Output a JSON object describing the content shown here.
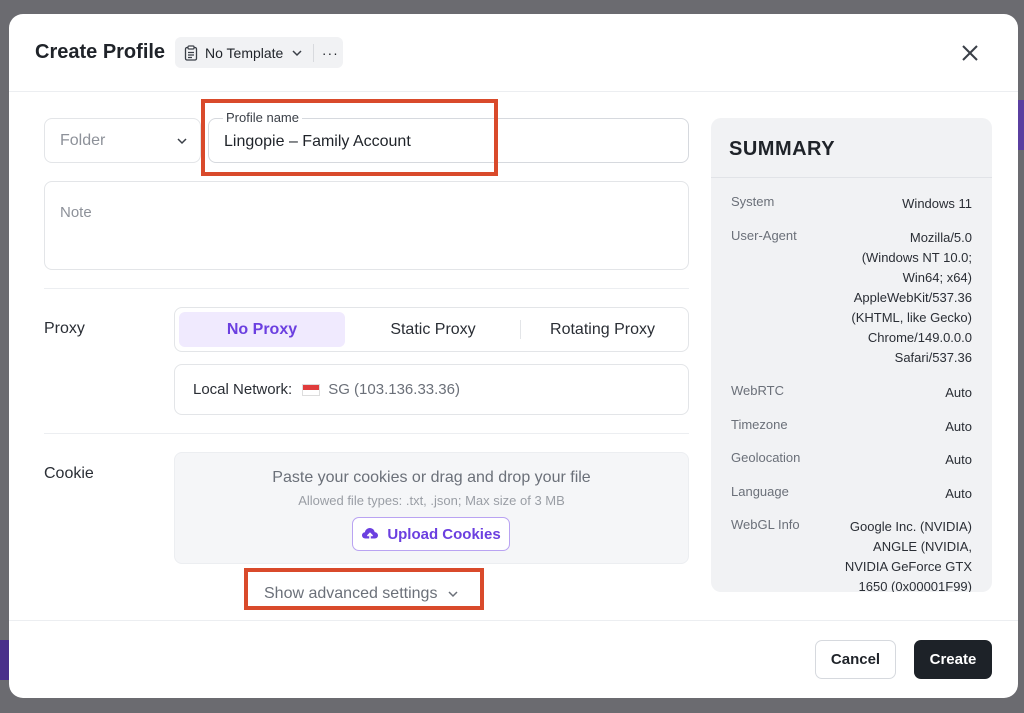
{
  "dialog": {
    "title": "Create Profile",
    "template_label": "No Template",
    "more_label": "···"
  },
  "form": {
    "folder_placeholder": "Folder",
    "profile_name_label": "Profile name",
    "profile_name_value": "Lingopie – Family Account",
    "note_placeholder": "Note",
    "proxy_label": "Proxy",
    "proxy_tabs": [
      {
        "label": "No Proxy",
        "active": true
      },
      {
        "label": "Static Proxy",
        "active": false
      },
      {
        "label": "Rotating Proxy",
        "active": false
      }
    ],
    "network_label": "Local Network:",
    "network_ip": "SG (103.136.33.36)",
    "cookie_label": "Cookie",
    "cookie_prompt": "Paste your cookies or drag and drop your file",
    "cookie_hint": "Allowed file types: .txt, .json; Max size of 3 MB",
    "upload_label": "Upload Cookies",
    "advanced_label": "Show advanced settings"
  },
  "summary": {
    "title": "SUMMARY",
    "rows": [
      {
        "key": "System",
        "value": "Windows 11"
      },
      {
        "key": "User-Agent",
        "value_lines": [
          "Mozilla/5.0",
          "(Windows NT 10.0;",
          "Win64; x64)",
          "AppleWebKit/537.36",
          "(KHTML, like Gecko)",
          "Chrome/149.0.0.0",
          "Safari/537.36"
        ]
      },
      {
        "key": "WebRTC",
        "value": "Auto"
      },
      {
        "key": "Timezone",
        "value": "Auto"
      },
      {
        "key": "Geolocation",
        "value": "Auto"
      },
      {
        "key": "Language",
        "value": "Auto"
      },
      {
        "key": "WebGL Info",
        "value_lines": [
          "Google Inc. (NVIDIA)",
          "ANGLE (NVIDIA,",
          "NVIDIA GeForce GTX",
          "1650 (0x00001F99)"
        ]
      }
    ]
  },
  "footer": {
    "cancel_label": "Cancel",
    "create_label": "Create"
  },
  "colors": {
    "accent": "#6b3fe0",
    "accent_bg": "#f0eafe",
    "primary_button": "#1d2228",
    "annotation": "#d94a2b"
  }
}
